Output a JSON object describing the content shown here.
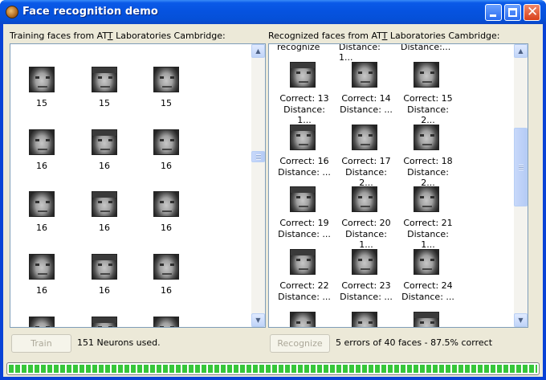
{
  "window": {
    "title": "Face recognition demo",
    "controls": {
      "minimize": "minimize-icon",
      "maximize": "maximize-icon",
      "close": "close-icon"
    }
  },
  "training": {
    "label_pre": "Training faces from AT",
    "label_u": "T",
    "label_post": " Laboratories Cambridge:",
    "rows": [
      [
        "15",
        "15",
        "15"
      ],
      [
        "16",
        "16",
        "16"
      ],
      [
        "16",
        "16",
        "16"
      ],
      [
        "16",
        "16",
        "16"
      ]
    ],
    "train_button": "Train",
    "status": "151 Neurons used."
  },
  "recognized": {
    "label_pre": "Recognized faces from AT",
    "label_u": "T",
    "label_post": " Laboratories Cambridge:",
    "top_partial": [
      "recognize",
      "Distance: 1...",
      "Distance:..."
    ],
    "rows": [
      [
        {
          "correct": "Correct: 13",
          "distance": "Distance: 1..."
        },
        {
          "correct": "Correct: 14",
          "distance": "Distance: ..."
        },
        {
          "correct": "Correct: 15",
          "distance": "Distance: 2..."
        }
      ],
      [
        {
          "correct": "Correct: 16",
          "distance": "Distance: ..."
        },
        {
          "correct": "Correct: 17",
          "distance": "Distance: 2..."
        },
        {
          "correct": "Correct: 18",
          "distance": "Distance: 2..."
        }
      ],
      [
        {
          "correct": "Correct: 19",
          "distance": "Distance: ..."
        },
        {
          "correct": "Correct: 20",
          "distance": "Distance: 1..."
        },
        {
          "correct": "Correct: 21",
          "distance": "Distance: 1..."
        }
      ],
      [
        {
          "correct": "Correct: 22",
          "distance": "Distance: ..."
        },
        {
          "correct": "Correct: 23",
          "distance": "Distance: ..."
        },
        {
          "correct": "Correct: 24",
          "distance": "Distance: ..."
        }
      ]
    ],
    "recognize_button": "Recognize",
    "status": "5 errors of 40 faces - 87.5% correct"
  },
  "progress": {
    "fraction": 1.0,
    "color": "#37c63a"
  },
  "colors": {
    "titlebar": "#0653e0",
    "client": "#ece9d8",
    "panel_border": "#7f9db9"
  },
  "scrollbars": {
    "left_thumb_fraction": 0.45,
    "right_thumb_fraction": 0.32
  }
}
